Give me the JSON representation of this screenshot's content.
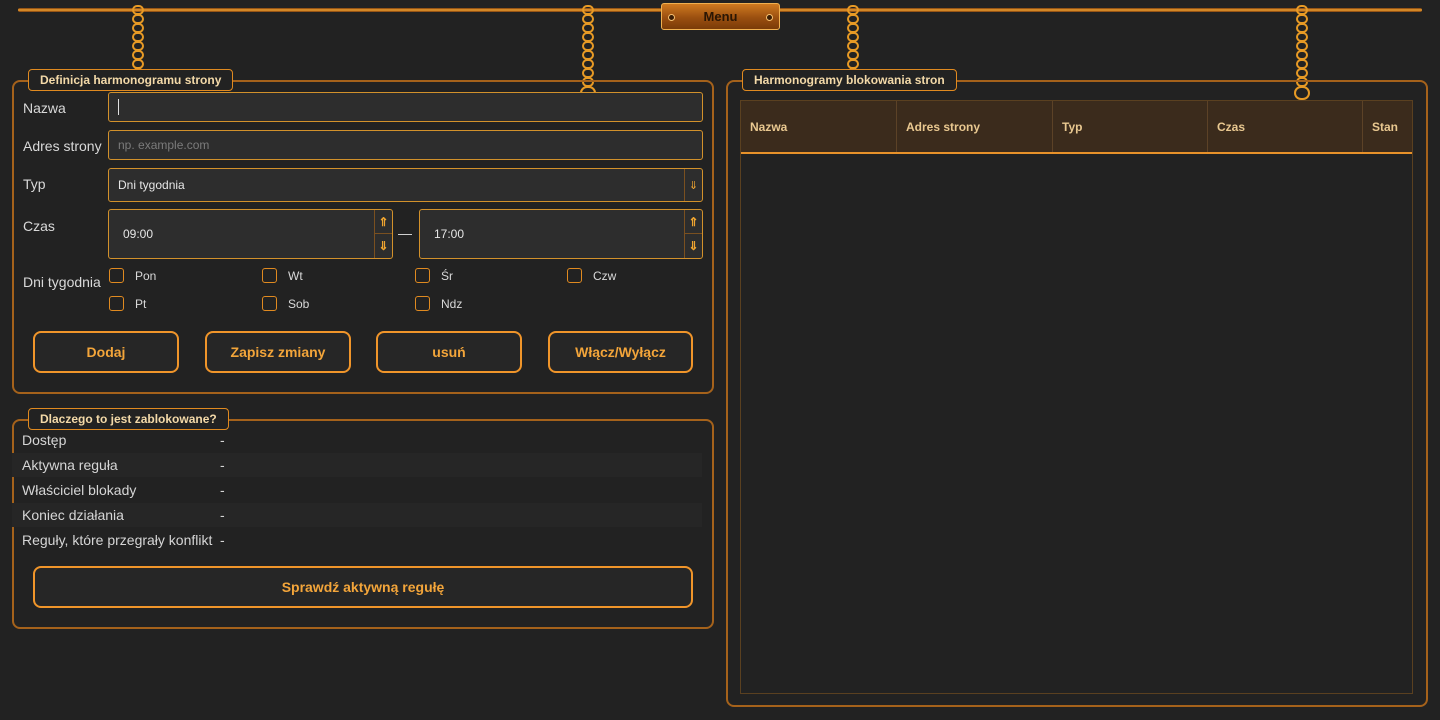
{
  "menu": {
    "label": "Menu"
  },
  "definition_panel": {
    "title": "Definicja harmonogramu strony",
    "name_label": "Nazwa",
    "name_value": "",
    "address_label": "Adres strony",
    "address_placeholder": "np. example.com",
    "type_label": "Typ",
    "type_value": "Dni tygodnia",
    "time_label": "Czas",
    "time_from": "09:00",
    "time_to": "17:00",
    "days_label": "Dni tygodnia",
    "days": [
      "Pon",
      "Wt",
      "Śr",
      "Czw",
      "Pt",
      "Sob",
      "Ndz"
    ],
    "buttons": {
      "add": "Dodaj",
      "save": "Zapisz zmiany",
      "delete": "usuń",
      "toggle": "Włącz/Wyłącz"
    }
  },
  "why_panel": {
    "title": "Dlaczego to jest zablokowane?",
    "rows": [
      {
        "key": "Dostęp",
        "value": "-"
      },
      {
        "key": "Aktywna reguła",
        "value": "-"
      },
      {
        "key": "Właściciel blokady",
        "value": "-"
      },
      {
        "key": "Koniec działania",
        "value": "-"
      },
      {
        "key": "Reguły, które przegrały konflikt",
        "value": "-"
      }
    ],
    "check_button": "Sprawdź aktywną regułę"
  },
  "schedules_panel": {
    "title": "Harmonogramy blokowania stron",
    "columns": [
      "Nazwa",
      "Adres strony",
      "Typ",
      "Czas",
      "Stan"
    ]
  },
  "colors": {
    "accent": "#f0952a",
    "background": "#222222",
    "header": "#3b2b1c"
  }
}
